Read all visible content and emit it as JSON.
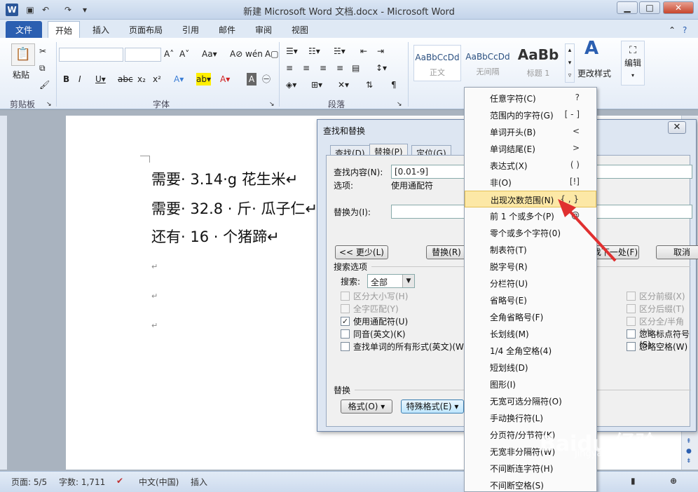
{
  "window": {
    "title": "新建 Microsoft Word 文档.docx - Microsoft Word"
  },
  "tabs": [
    "文件",
    "开始",
    "插入",
    "页面布局",
    "引用",
    "邮件",
    "审阅",
    "视图"
  ],
  "ribbon": {
    "paste_label": "粘贴",
    "groups": [
      "剪贴板",
      "字体",
      "段落"
    ],
    "styles": [
      {
        "sample": "AaBbCcDd",
        "name": "正文"
      },
      {
        "sample": "AaBbCcDd",
        "name": "无间隔"
      },
      {
        "sample": "AaBb",
        "name": "标题 1"
      }
    ],
    "change_styles_label": "更改样式",
    "edit_label": "编辑"
  },
  "document": {
    "lines": [
      "需要· 3.14·g 花生米↵",
      "需要· 32.8 · 斤· 瓜子仁↵",
      "还有· 16 · 个猪蹄↵"
    ],
    "para_mark": "↵"
  },
  "status": {
    "page": "页面: 5/5",
    "words": "字数: 1,711",
    "language": "中文(中国)",
    "mode": "插入"
  },
  "dialog": {
    "title": "查找和替换",
    "tabs": [
      "查找(D)",
      "替换(P)",
      "定位(G)"
    ],
    "find_label": "查找内容(N):",
    "find_value": "[0.01-9]",
    "options_label": "选项:",
    "options_value": "使用通配符",
    "replace_label": "替换为(I):",
    "less_button": "<< 更少(L)",
    "replace_button": "替换(R)",
    "find_next_button": "找下一处(F)",
    "cancel_button": "取消",
    "search_options_label": "搜索选项",
    "search_label": "搜索:",
    "search_value": "全部",
    "options_left": [
      {
        "label": "区分大小写(H)",
        "checked": false,
        "disabled": true
      },
      {
        "label": "全字匹配(Y)",
        "checked": false,
        "disabled": true
      },
      {
        "label": "使用通配符(U)",
        "checked": true,
        "disabled": false
      },
      {
        "label": "同音(英文)(K)",
        "checked": false,
        "disabled": false
      },
      {
        "label": "查找单词的所有形式(英文)(W)",
        "checked": false,
        "disabled": false
      }
    ],
    "options_right": [
      {
        "label": "区分前缀(X)",
        "checked": false,
        "disabled": true
      },
      {
        "label": "区分后缀(T)",
        "checked": false,
        "disabled": true
      },
      {
        "label": "区分全/半角(M)",
        "checked": false,
        "disabled": true
      },
      {
        "label": "忽略标点符号(S)",
        "checked": false,
        "disabled": false
      },
      {
        "label": "忽略空格(W)",
        "checked": false,
        "disabled": false
      }
    ],
    "replace_section_label": "替换",
    "format_button": "格式(O) ▾",
    "special_button": "特殊格式(E) ▾"
  },
  "menu": {
    "highlighted_index": 6,
    "items": [
      {
        "label": "任意字符(C)",
        "symbol": "?"
      },
      {
        "label": "范围内的字符(G)",
        "symbol": "[ - ]"
      },
      {
        "label": "单词开头(B)",
        "symbol": "<"
      },
      {
        "label": "单词结尾(E)",
        "symbol": ">"
      },
      {
        "label": "表达式(X)",
        "symbol": "( )"
      },
      {
        "label": "非(O)",
        "symbol": "[!]"
      },
      {
        "label": "出现次数范围(N)",
        "symbol": "{ , }"
      },
      {
        "label": "前 1 个或多个(P)",
        "symbol": "@"
      },
      {
        "label": "零个或多个字符(0)",
        "symbol": ""
      },
      {
        "label": "制表符(T)",
        "symbol": ""
      },
      {
        "label": "脱字号(R)",
        "symbol": ""
      },
      {
        "label": "分栏符(U)",
        "symbol": ""
      },
      {
        "label": "省略号(E)",
        "symbol": ""
      },
      {
        "label": "全角省略号(F)",
        "symbol": ""
      },
      {
        "label": "长划线(M)",
        "symbol": ""
      },
      {
        "label": "1/4 全角空格(4)",
        "symbol": ""
      },
      {
        "label": "短划线(D)",
        "symbol": ""
      },
      {
        "label": "图形(I)",
        "symbol": ""
      },
      {
        "label": "无宽可选分隔符(O)",
        "symbol": ""
      },
      {
        "label": "手动换行符(L)",
        "symbol": ""
      },
      {
        "label": "分页符/分节符(K)",
        "symbol": ""
      },
      {
        "label": "无宽非分隔符(W)",
        "symbol": ""
      },
      {
        "label": "不间断连字符(H)",
        "symbol": ""
      },
      {
        "label": "不间断空格(S)",
        "symbol": ""
      }
    ]
  },
  "watermark": {
    "brand": "Baidu 经验",
    "url": "jingyan.baidu.com"
  },
  "colors": {
    "accent": "#2b5fb1",
    "highlight": "#fce8a6",
    "arrow": "#e03030"
  }
}
